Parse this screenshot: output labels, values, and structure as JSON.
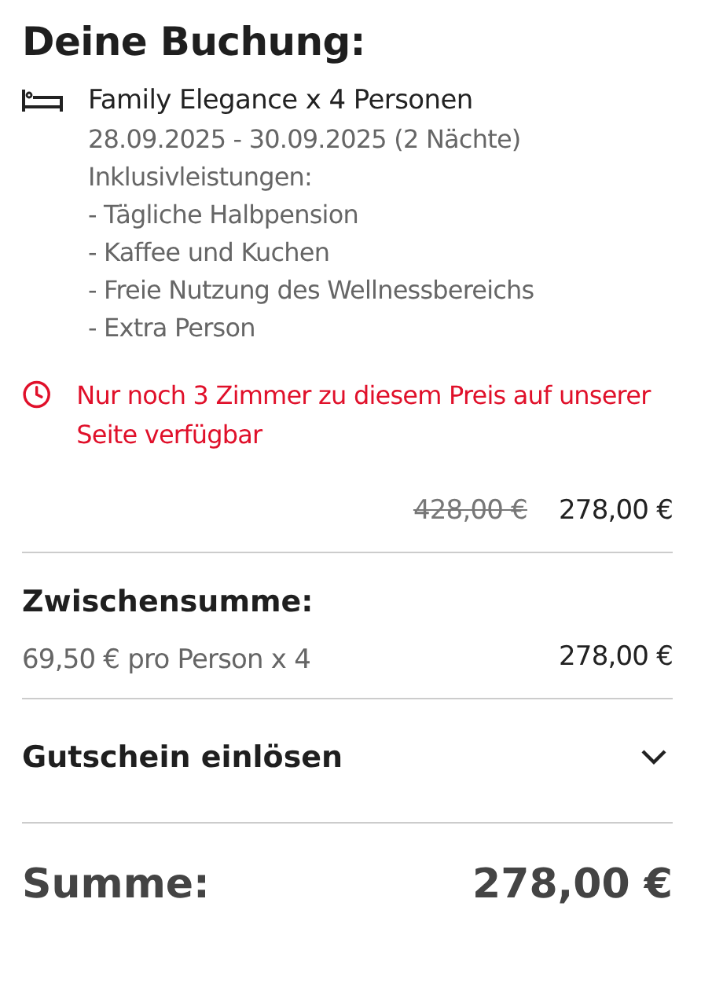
{
  "title": "Deine Buchung:",
  "room": {
    "name": "Family Elegance x 4 Personen",
    "dates": "28.09.2025 - 30.09.2025 (2 Nächte)",
    "inclusions_label": "Inklusivleistungen:",
    "inclusions": [
      "- Tägliche Halbpension",
      "- Kaffee und Kuchen",
      "- Freie Nutzung des Wellnessbereichs",
      "- Extra Person"
    ]
  },
  "notice": "Nur noch 3 Zimmer zu diesem Preis auf unserer Seite verfügbar",
  "price": {
    "old": "428,00 €",
    "current": "278,00 €"
  },
  "subtotal": {
    "label": "Zwischensumme:",
    "detail": "69,50 € pro Person x 4",
    "amount": "278,00 €"
  },
  "voucher": {
    "label": "Gutschein einlösen",
    "expanded": false
  },
  "total": {
    "label": "Summe:",
    "amount": "278,00 €"
  }
}
